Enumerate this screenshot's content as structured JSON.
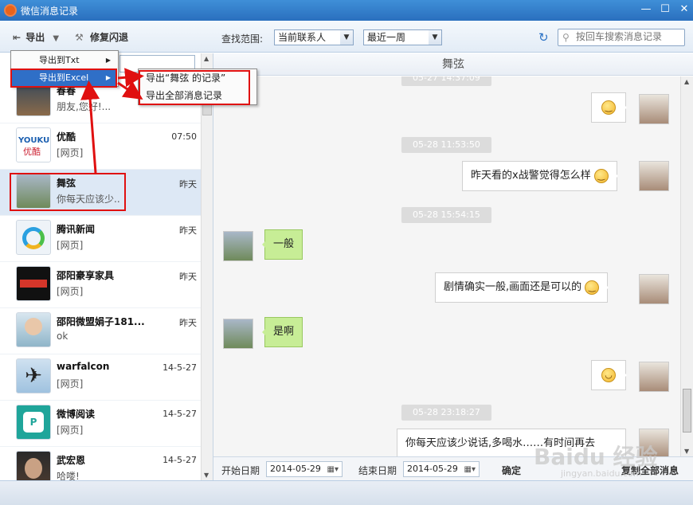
{
  "window": {
    "title": "微信消息记录"
  },
  "toolbar": {
    "export_label": "导出",
    "repair_label": "修复闪退",
    "range_label": "查找范围:",
    "range_value": "当前联系人",
    "period_value": "最近一周",
    "search_placeholder": "按回车搜索消息记录"
  },
  "menu": {
    "items": [
      {
        "label": "导出到Txt"
      },
      {
        "label": "导出到Excel"
      }
    ],
    "submenu": [
      {
        "label": "导出“舞弦 的记录”"
      },
      {
        "label": "导出全部消息记录"
      }
    ]
  },
  "contacts": [
    {
      "name": "春春",
      "msg": "朋友,您好!...",
      "time": ""
    },
    {
      "name": "优酷",
      "msg": "[网页]",
      "time": "07:50"
    },
    {
      "name": "舞弦",
      "msg": "你每天应该少..",
      "time": "昨天"
    },
    {
      "name": "腾讯新闻",
      "msg": "[网页]",
      "time": "昨天"
    },
    {
      "name": "邵阳豪享家具",
      "msg": "[网页]",
      "time": "昨天"
    },
    {
      "name": "邵阳微盟娟子181...",
      "msg": "ok",
      "time": "昨天"
    },
    {
      "name": "warfalcon",
      "msg": "[网页]",
      "time": "14-5-27"
    },
    {
      "name": "微博阅读",
      "msg": "[网页]",
      "time": "14-5-27"
    },
    {
      "name": "武宏恩",
      "msg": "哈喽!",
      "time": "14-5-27"
    }
  ],
  "chat": {
    "header": "舞弦",
    "timestamps": [
      "05-27 14:37:09",
      "05-28 11:53:50",
      "05-28 15:54:15",
      "05-28 23:18:27"
    ],
    "messages": [
      {
        "text": "昨天看的x战警觉得怎么样"
      },
      {
        "text": "一般"
      },
      {
        "text": "剧情确实一般,画面还是可以的"
      },
      {
        "text": "是啊"
      },
      {
        "text": "你每天应该少说话,多喝水……有时间再去"
      }
    ]
  },
  "datebar": {
    "start_label": "开始日期",
    "start_value": "2014-05-29",
    "end_label": "结束日期",
    "end_value": "2014-05-29",
    "ok_label": "确定",
    "copy_label": "复制全部消息"
  },
  "watermark": {
    "text": "Baidu 经验",
    "url": "jingyan.baidu.com"
  },
  "colors": {
    "accent": "#2f6fc7",
    "annotation": "#e01010",
    "bubble_green": "#c7ed96"
  }
}
